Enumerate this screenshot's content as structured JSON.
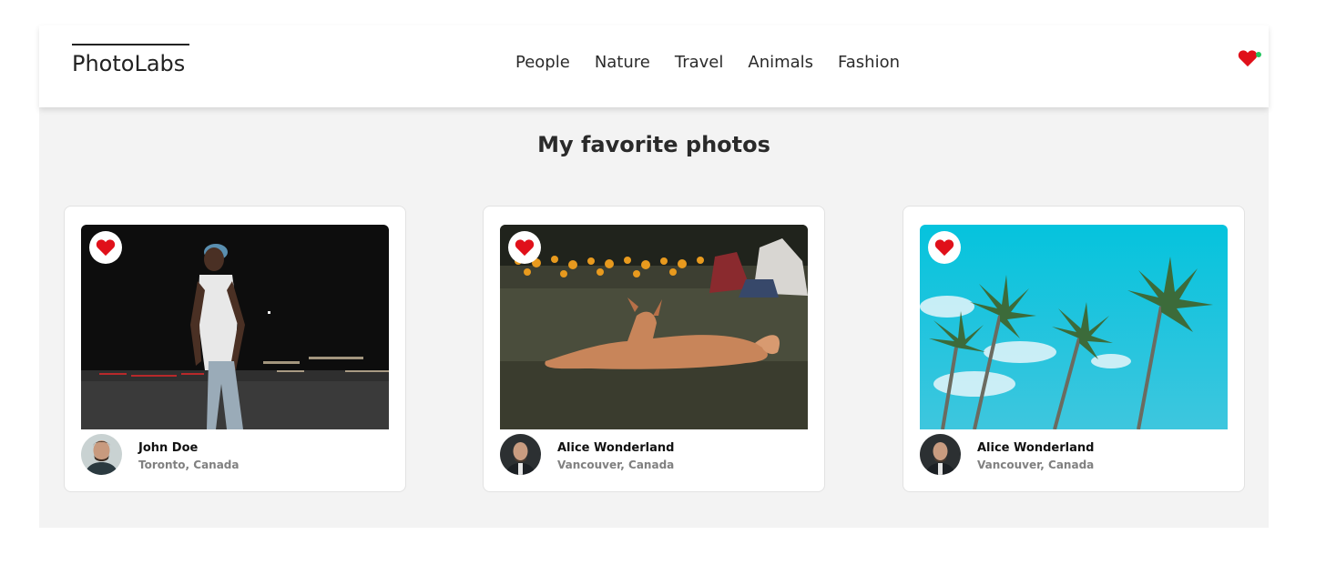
{
  "topbar": {
    "logo": "PhotoLabs",
    "nav": [
      "People",
      "Nature",
      "Travel",
      "Animals",
      "Fashion"
    ],
    "favorites_icon": "heart-icon",
    "favorites_indicator_color": "#22c55e"
  },
  "page": {
    "title": "My favorite photos"
  },
  "colors": {
    "heart": "#e0101a",
    "background": "#f3f3f3",
    "card": "#ffffff"
  },
  "photos": [
    {
      "user": {
        "name": "John Doe",
        "location": "Toronto, Canada"
      },
      "liked": true,
      "subject": "man-in-cap-at-night"
    },
    {
      "user": {
        "name": "Alice Wonderland",
        "location": "Vancouver, Canada"
      },
      "liked": true,
      "subject": "dog-lying-on-grass"
    },
    {
      "user": {
        "name": "Alice Wonderland",
        "location": "Vancouver, Canada"
      },
      "liked": true,
      "subject": "palm-trees-blue-sky"
    }
  ]
}
